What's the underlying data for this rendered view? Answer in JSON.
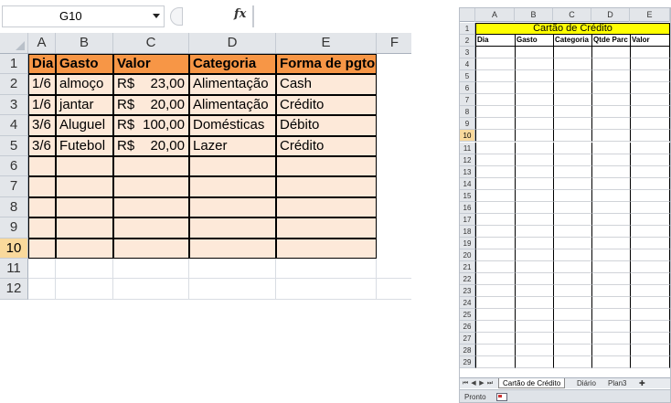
{
  "left_sheet": {
    "name_box": "G10",
    "formula_icon": "fx",
    "columns": [
      "A",
      "B",
      "C",
      "D",
      "E",
      "F"
    ],
    "row_numbers": [
      "1",
      "2",
      "3",
      "4",
      "5",
      "6",
      "7",
      "8",
      "9",
      "10",
      "11",
      "12"
    ],
    "selected_row": "10",
    "header": [
      "Dia",
      "Gasto",
      "Valor",
      "Categoria",
      "Forma de pgto"
    ],
    "rows": [
      {
        "dia": "1/6",
        "gasto": "almoço",
        "currency": "R$",
        "amount": "23,00",
        "categoria": "Alimentação",
        "forma": "Cash"
      },
      {
        "dia": "1/6",
        "gasto": "jantar",
        "currency": "R$",
        "amount": "20,00",
        "categoria": "Alimentação",
        "forma": "Crédito"
      },
      {
        "dia": "3/6",
        "gasto": "Aluguel",
        "currency": "R$",
        "amount": "100,00",
        "categoria": "Domésticas",
        "forma": "Débito"
      },
      {
        "dia": "3/6",
        "gasto": "Futebol",
        "currency": "R$",
        "amount": "20,00",
        "categoria": "Lazer",
        "forma": "Crédito"
      }
    ],
    "colors": {
      "header_fill": "#F79646",
      "body_fill": "#FDE9D9",
      "selected_header": "#F9D99C"
    }
  },
  "right_sheet": {
    "columns": [
      "A",
      "B",
      "C",
      "D",
      "E"
    ],
    "title": "Cartão de Crédito",
    "header": [
      "Dia",
      "Gasto",
      "Categoria",
      "Qtde Parc",
      "Valor"
    ],
    "row_numbers": [
      "1",
      "2",
      "3",
      "4",
      "5",
      "6",
      "7",
      "8",
      "9",
      "10",
      "11",
      "12",
      "13",
      "14",
      "15",
      "16",
      "17",
      "18",
      "19",
      "20",
      "21",
      "22",
      "23",
      "24",
      "25",
      "26",
      "27",
      "28",
      "29"
    ],
    "selected_row": "10",
    "tabs": [
      "Cartão de Crédito",
      "Diário",
      "Plan3"
    ],
    "active_tab": "Cartão de Crédito",
    "nav_buttons": [
      "⏮",
      "◀",
      "▶",
      "⏭"
    ],
    "status": "Pronto",
    "colors": {
      "title_fill": "#FFFF00"
    }
  }
}
